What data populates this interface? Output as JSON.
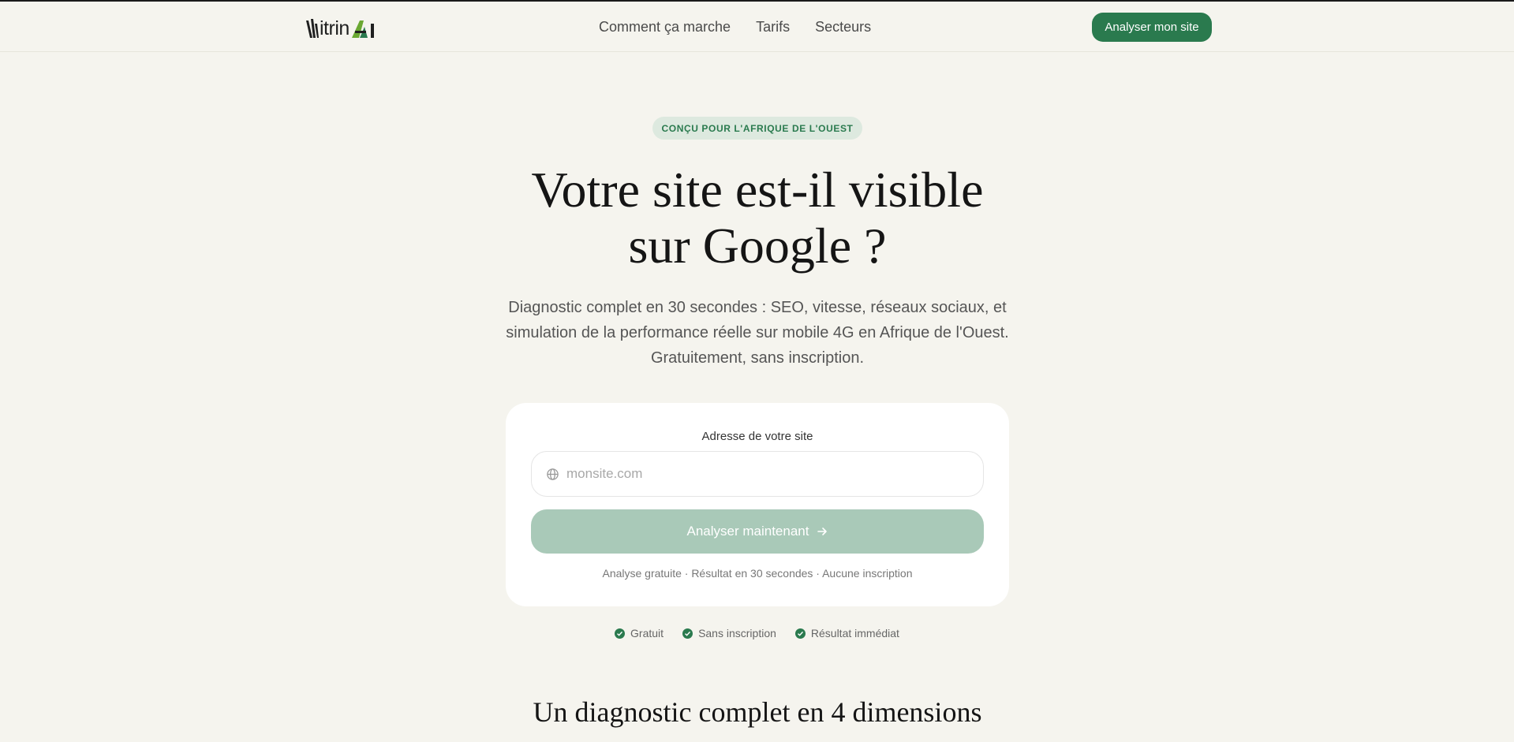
{
  "header": {
    "logo_text": "VitrinAI",
    "nav": [
      {
        "label": "Comment ça marche"
      },
      {
        "label": "Tarifs"
      },
      {
        "label": "Secteurs"
      }
    ],
    "cta_label": "Analyser mon site"
  },
  "hero": {
    "badge": "CONÇU POUR L'AFRIQUE DE L'OUEST",
    "title_line1": "Votre site est-il visible",
    "title_line2": "sur Google ?",
    "subtitle": "Diagnostic complet en 30 secondes : SEO, vitesse, réseaux sociaux, et simulation de la performance réelle sur mobile 4G en Afrique de l'Ouest. Gratuitement, sans inscription."
  },
  "form": {
    "label": "Adresse de votre site",
    "input_placeholder": "monsite.com",
    "input_value": "",
    "submit_label": "Analyser maintenant",
    "note": "Analyse gratuite · Résultat en 30 secondes · Aucune inscription"
  },
  "features": [
    {
      "label": "Gratuit"
    },
    {
      "label": "Sans inscription"
    },
    {
      "label": "Résultat immédiat"
    }
  ],
  "section_title": "Un diagnostic complet en 4 dimensions",
  "colors": {
    "accent": "#2a7a4e",
    "button_disabled": "#a9c9b8",
    "background": "#f5f4ee",
    "badge_bg": "#dde9df"
  },
  "icons": {
    "input": "globe-icon",
    "submit": "arrow-right-icon",
    "feature": "check-circle-icon"
  }
}
